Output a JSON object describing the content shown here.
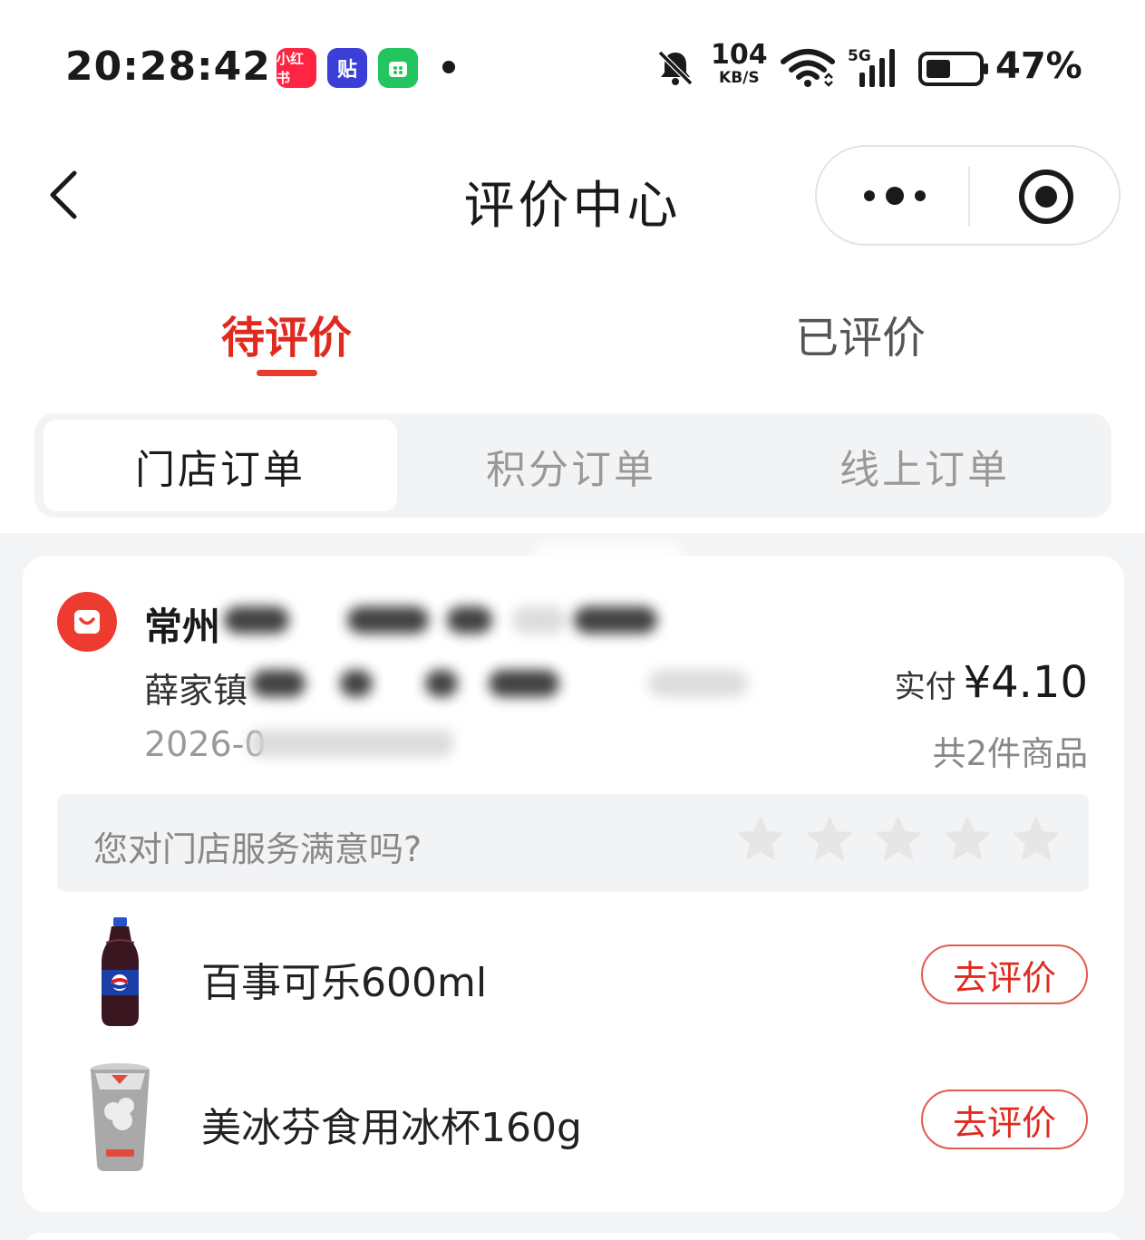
{
  "status_bar": {
    "time": "20:28:42",
    "app_icons": [
      {
        "name": "xiaohongshu-icon",
        "label": "小红书"
      },
      {
        "name": "tieba-icon",
        "label": "贴"
      },
      {
        "name": "green-app-icon",
        "label": ""
      }
    ],
    "net_speed_value": "104",
    "net_speed_unit": "KB/S",
    "signal_label": "5G",
    "battery_percent": "47%"
  },
  "nav": {
    "title": "评价中心"
  },
  "main_tabs": [
    {
      "label": "待评价",
      "active": true
    },
    {
      "label": "已评价",
      "active": false
    }
  ],
  "segments": [
    {
      "label": "门店订单",
      "active": true
    },
    {
      "label": "积分订单",
      "active": false
    },
    {
      "label": "线上订单",
      "active": false
    }
  ],
  "order": {
    "store_name": "常州",
    "store_address": "薛家镇",
    "order_time": "2026-0",
    "paid_label": "实付",
    "paid_amount": "¥4.10",
    "item_count": "共2件商品",
    "rating_question": "您对门店服务满意吗?",
    "rating_stars": 0,
    "rating_max": 5,
    "products": [
      {
        "name": "百事可乐600ml",
        "button": "去评价",
        "image": "pepsi-bottle"
      },
      {
        "name": "美冰芬食用冰杯160g",
        "button": "去评价",
        "image": "ice-cup"
      }
    ]
  },
  "colors": {
    "accent": "#e02a1f",
    "segment_bg": "#f2f3f5",
    "list_bg": "#f3f4f6",
    "star_inactive": "#e6e6e6"
  }
}
